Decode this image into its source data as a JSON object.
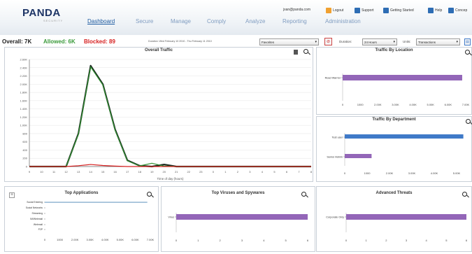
{
  "header": {
    "logo_text": "PANDA",
    "logo_sub": "SECURITY",
    "nav": [
      "Dashboard",
      "Secure",
      "Manage",
      "Comply",
      "Analyze",
      "Reporting",
      "Administration"
    ],
    "active_nav": "Dashboard",
    "user_email": "jxan@panda.com",
    "links": [
      "Logout",
      "Support",
      "Getting Started",
      "Help",
      "Concep"
    ]
  },
  "summary": {
    "overall": "Overall: 7K",
    "allowed": "Allowed: 6K",
    "blocked": "Blocked: 89",
    "duration_text": "Duration: Wed February 10 2010 - Thu February 11 2010"
  },
  "controls": {
    "favorites": "Favorites",
    "duration_label": "Duration:",
    "duration_value": "24 Hours",
    "units_label": "Units:",
    "units_value": "Transactions"
  },
  "colors": {
    "allowed": "#3a9a3a",
    "blocked": "#d62020",
    "line_total": "#1d2b22",
    "line_allowed": "#2f8f2f",
    "line_blocked": "#d62020",
    "bar_purple": "#9366b8",
    "bar_blue": "#3f7ac8"
  },
  "panels": {
    "overall_traffic": {
      "title": "Overall Traffic"
    },
    "traffic_by_location": {
      "title": "Traffic By Location"
    },
    "traffic_by_department": {
      "title": "Traffic By Department"
    },
    "top_applications": {
      "title": "Top Applications"
    },
    "top_viruses": {
      "title": "Top Viruses and Spywares"
    },
    "advanced_threats": {
      "title": "Advanced Threats"
    }
  },
  "chart_data": [
    {
      "type": "line",
      "title": "Overall Traffic",
      "xlabel": "Time of day (hours)",
      "ylabel": "",
      "x": [
        "9",
        "10",
        "11",
        "12",
        "13",
        "14",
        "15",
        "16",
        "17",
        "18",
        "19",
        "20",
        "21",
        "22",
        "23",
        "0",
        "1",
        "2",
        "3",
        "4",
        "5",
        "6",
        "7",
        "8"
      ],
      "yticks": [
        "0",
        "200",
        "400",
        "600",
        "800",
        "1.00K",
        "1.20K",
        "1.40K",
        "1.60K",
        "1.80K",
        "2.00K",
        "2.20K",
        "2.40K",
        "2.60K"
      ],
      "ylim": [
        0,
        2600
      ],
      "series": [
        {
          "values": [
            0,
            0,
            0,
            0,
            800,
            2450,
            2000,
            900,
            150,
            20,
            0,
            50,
            0,
            0,
            0,
            0,
            0,
            0,
            0,
            0,
            0,
            0,
            0,
            0
          ]
        },
        {
          "values": [
            0,
            0,
            0,
            0,
            780,
            2420,
            1980,
            880,
            140,
            15,
            80,
            10,
            0,
            0,
            0,
            0,
            0,
            0,
            0,
            0,
            0,
            0,
            0,
            0
          ]
        },
        {
          "values": [
            0,
            0,
            0,
            0,
            20,
            50,
            25,
            10,
            0,
            0,
            0,
            0,
            0,
            0,
            0,
            0,
            0,
            0,
            0,
            0,
            0,
            0,
            0,
            0
          ]
        }
      ]
    },
    {
      "type": "bar",
      "title": "Traffic By Location",
      "categories": [
        "Road Warrior"
      ],
      "values": [
        6800
      ],
      "xticks": [
        "0",
        "1000",
        "2.00K",
        "3.00K",
        "4.00K",
        "5.00K",
        "6.00K",
        "7.00K"
      ],
      "xlim": [
        0,
        7000
      ]
    },
    {
      "type": "bar",
      "title": "Traffic By Department",
      "categories": [
        "Test user",
        "Senior Admin"
      ],
      "values": [
        5300,
        1200
      ],
      "xticks": [
        "0",
        "1000",
        "2.00K",
        "3.00K",
        "4.00K",
        "5.00K"
      ],
      "xlim": [
        0,
        5500
      ]
    },
    {
      "type": "bar",
      "title": "Top Applications",
      "categories": [
        "Social Entering",
        "Social Networks",
        "Streaming",
        "IM/Webmail",
        "Webmail",
        "P2P"
      ],
      "values": [
        6800,
        0,
        0,
        0,
        0,
        0
      ],
      "xticks": [
        "0",
        "1000",
        "2.00K",
        "3.00K",
        "4.00K",
        "5.00K",
        "6.00K",
        "7.00K"
      ],
      "xlim": [
        0,
        7000
      ]
    },
    {
      "type": "bar",
      "title": "Top Viruses and Spywares",
      "categories": [
        "Virus"
      ],
      "values": [
        6
      ],
      "xticks": [
        "0",
        "1",
        "2",
        "3",
        "4",
        "5",
        "6"
      ],
      "xlim": [
        0,
        6
      ]
    },
    {
      "type": "bar",
      "title": "Advanced Threats",
      "categories": [
        "Corporate Only"
      ],
      "values": [
        6
      ],
      "xticks": [
        "0",
        "1",
        "2",
        "3",
        "4",
        "5",
        "6"
      ],
      "xlim": [
        0,
        6
      ]
    }
  ]
}
